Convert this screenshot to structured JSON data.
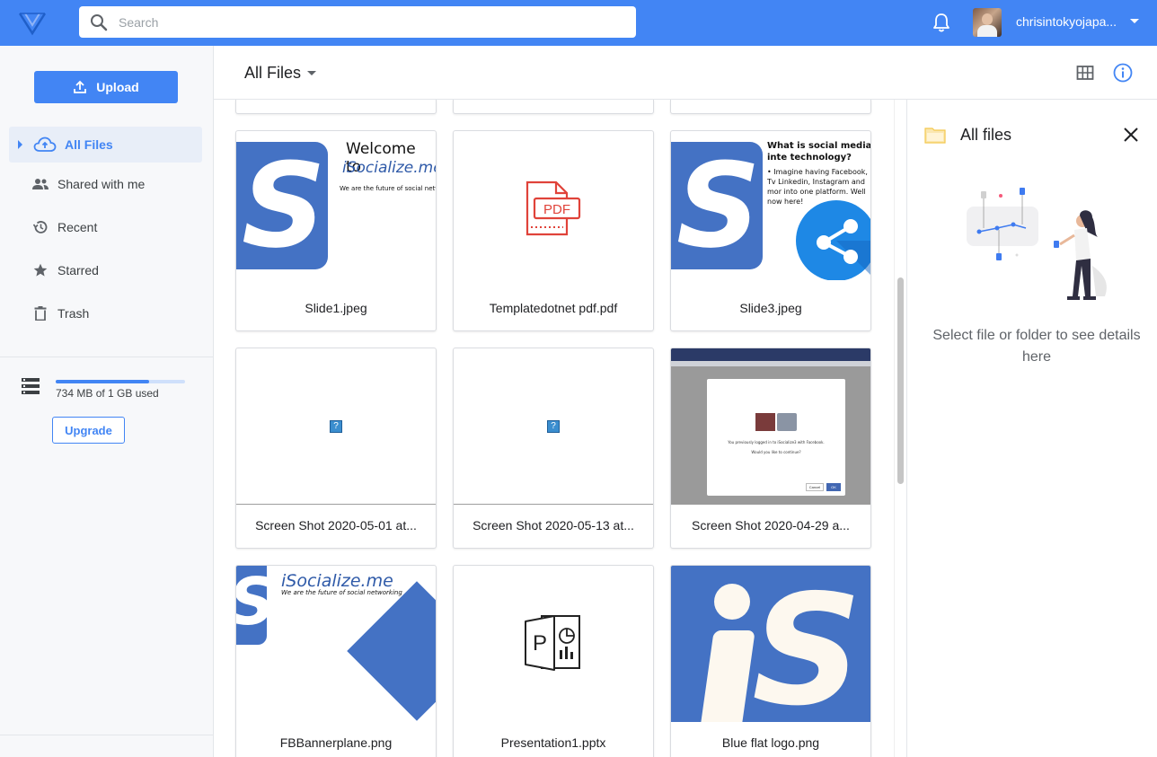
{
  "header": {
    "search_placeholder": "Search",
    "username": "chrisintokyojapa...",
    "accent_color": "#4285f4"
  },
  "sidebar": {
    "upload_label": "Upload",
    "items": [
      {
        "label": "All Files",
        "icon": "cloud-upload-icon",
        "active": true
      },
      {
        "label": "Shared with me",
        "icon": "people-icon"
      },
      {
        "label": "Recent",
        "icon": "history-icon"
      },
      {
        "label": "Starred",
        "icon": "star-icon"
      },
      {
        "label": "Trash",
        "icon": "trash-icon"
      }
    ],
    "storage": {
      "text": "734 MB of 1 GB used",
      "used_fraction": 0.72
    },
    "upgrade_label": "Upgrade"
  },
  "main": {
    "title": "All Files",
    "files": [
      {
        "name": "Slide1.jpeg",
        "thumb": "slide1"
      },
      {
        "name": "Templatedotnet pdf.pdf",
        "thumb": "pdf-icon"
      },
      {
        "name": "Slide3.jpeg",
        "thumb": "slide3"
      },
      {
        "name": "Screen Shot 2020-05-01 at...",
        "thumb": "broken-image"
      },
      {
        "name": "Screen Shot 2020-05-13 at...",
        "thumb": "broken-image"
      },
      {
        "name": "Screen Shot 2020-04-29 a...",
        "thumb": "screenshot-dialog"
      },
      {
        "name": "FBBannerplane.png",
        "thumb": "fb-banner"
      },
      {
        "name": "Presentation1.pptx",
        "thumb": "pptx-icon"
      },
      {
        "name": "Blue flat logo.png",
        "thumb": "blue-logo"
      }
    ],
    "thumb_text": {
      "slide1_heading": "Welcome to",
      "slide1_brand": "iSocialize.me",
      "slide1_tag": "We are the future of social network",
      "slide3_heading": "What is social media inte technology?",
      "slide3_bullet": "• Imagine having Facebook, Tv Linkedin, Instagram and mor into one platform. Well now here!",
      "pdf_label": "PDF",
      "banner_brand": "iSocialize.me",
      "banner_tag": "We are the future of social networking",
      "dialog_text1": "You previously logged in to iSocialize3 with Facebook.",
      "dialog_text2": "Would you like to continue?",
      "dialog_cancel": "Cancel",
      "dialog_ok": "OK",
      "broken_mark": "?"
    }
  },
  "details": {
    "title": "All files",
    "hint": "Select file or folder to see details here"
  }
}
